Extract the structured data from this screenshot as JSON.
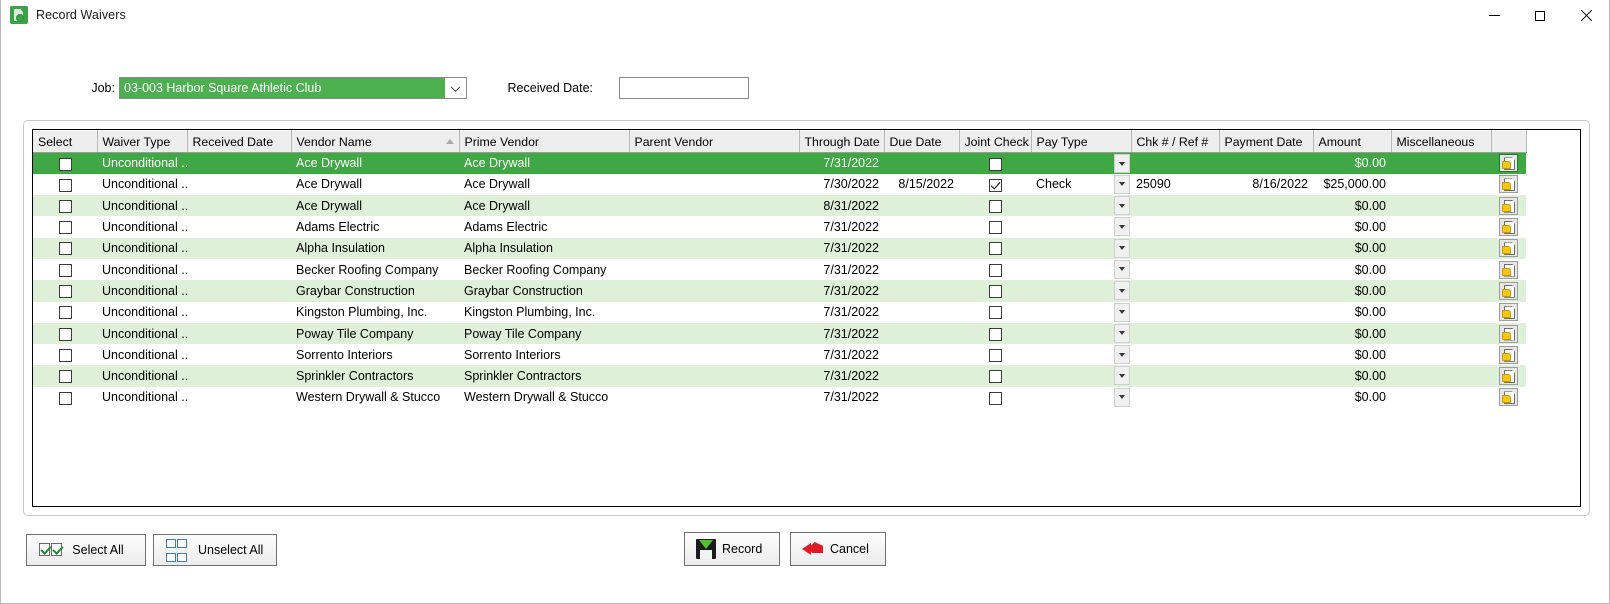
{
  "window": {
    "title": "Record Waivers",
    "icon": "record-waivers-icon",
    "minimize_label": "—",
    "maximize_label": "□",
    "close_label": "✕"
  },
  "form": {
    "job_label": "Job:",
    "job_value": "03-003  Harbor Square Athletic Club",
    "received_date_label": "Received Date:",
    "received_date_value": "",
    "received_date_placeholder": ""
  },
  "grid": {
    "columns": [
      {
        "key": "select",
        "label": "Select"
      },
      {
        "key": "waiver",
        "label": "Waiver Type"
      },
      {
        "key": "received",
        "label": "Received Date"
      },
      {
        "key": "vendor",
        "label": "Vendor Name",
        "sorted": "asc"
      },
      {
        "key": "prime",
        "label": "Prime Vendor"
      },
      {
        "key": "parent",
        "label": "Parent Vendor"
      },
      {
        "key": "through",
        "label": "Through Date"
      },
      {
        "key": "due",
        "label": "Due Date"
      },
      {
        "key": "joint",
        "label": "Joint Check"
      },
      {
        "key": "paytype",
        "label": "Pay Type"
      },
      {
        "key": "chk",
        "label": "Chk # / Ref #"
      },
      {
        "key": "payment",
        "label": "Payment Date"
      },
      {
        "key": "amount",
        "label": "Amount"
      },
      {
        "key": "misc",
        "label": "Miscellaneous"
      },
      {
        "key": "action",
        "label": ""
      }
    ],
    "rows": [
      {
        "select": false,
        "waiver": "Unconditional ...",
        "received": "",
        "vendor": "Ace Drywall",
        "prime": "Ace Drywall",
        "parent": "",
        "through": "7/31/2022",
        "due": "",
        "joint": false,
        "paytype": "",
        "chk": "",
        "payment": "",
        "amount": "$0.00",
        "misc": "",
        "selected": true
      },
      {
        "select": false,
        "waiver": "Unconditional ...",
        "received": "",
        "vendor": "Ace Drywall",
        "prime": "Ace Drywall",
        "parent": "",
        "through": "7/30/2022",
        "due": "8/15/2022",
        "joint": true,
        "paytype": "Check",
        "chk": "25090",
        "payment": "8/16/2022",
        "amount": "$25,000.00",
        "misc": "",
        "selected": false
      },
      {
        "select": false,
        "waiver": "Unconditional ...",
        "received": "",
        "vendor": "Ace Drywall",
        "prime": "Ace Drywall",
        "parent": "",
        "through": "8/31/2022",
        "due": "",
        "joint": false,
        "paytype": "",
        "chk": "",
        "payment": "",
        "amount": "$0.00",
        "misc": "",
        "selected": false
      },
      {
        "select": false,
        "waiver": "Unconditional ...",
        "received": "",
        "vendor": "Adams Electric",
        "prime": "Adams Electric",
        "parent": "",
        "through": "7/31/2022",
        "due": "",
        "joint": false,
        "paytype": "",
        "chk": "",
        "payment": "",
        "amount": "$0.00",
        "misc": "",
        "selected": false
      },
      {
        "select": false,
        "waiver": "Unconditional ...",
        "received": "",
        "vendor": "Alpha Insulation",
        "prime": "Alpha Insulation",
        "parent": "",
        "through": "7/31/2022",
        "due": "",
        "joint": false,
        "paytype": "",
        "chk": "",
        "payment": "",
        "amount": "$0.00",
        "misc": "",
        "selected": false
      },
      {
        "select": false,
        "waiver": "Unconditional ...",
        "received": "",
        "vendor": "Becker Roofing Company",
        "prime": "Becker Roofing Company",
        "parent": "",
        "through": "7/31/2022",
        "due": "",
        "joint": false,
        "paytype": "",
        "chk": "",
        "payment": "",
        "amount": "$0.00",
        "misc": "",
        "selected": false
      },
      {
        "select": false,
        "waiver": "Unconditional ...",
        "received": "",
        "vendor": "Graybar Construction",
        "prime": "Graybar Construction",
        "parent": "",
        "through": "7/31/2022",
        "due": "",
        "joint": false,
        "paytype": "",
        "chk": "",
        "payment": "",
        "amount": "$0.00",
        "misc": "",
        "selected": false
      },
      {
        "select": false,
        "waiver": "Unconditional ...",
        "received": "",
        "vendor": "Kingston Plumbing, Inc.",
        "prime": "Kingston Plumbing, Inc.",
        "parent": "",
        "through": "7/31/2022",
        "due": "",
        "joint": false,
        "paytype": "",
        "chk": "",
        "payment": "",
        "amount": "$0.00",
        "misc": "",
        "selected": false
      },
      {
        "select": false,
        "waiver": "Unconditional ...",
        "received": "",
        "vendor": "Poway Tile Company",
        "prime": "Poway Tile Company",
        "parent": "",
        "through": "7/31/2022",
        "due": "",
        "joint": false,
        "paytype": "",
        "chk": "",
        "payment": "",
        "amount": "$0.00",
        "misc": "",
        "selected": false
      },
      {
        "select": false,
        "waiver": "Unconditional ...",
        "received": "",
        "vendor": "Sorrento Interiors",
        "prime": "Sorrento Interiors",
        "parent": "",
        "through": "7/31/2022",
        "due": "",
        "joint": false,
        "paytype": "",
        "chk": "",
        "payment": "",
        "amount": "$0.00",
        "misc": "",
        "selected": false
      },
      {
        "select": false,
        "waiver": "Unconditional ...",
        "received": "",
        "vendor": "Sprinkler Contractors",
        "prime": "Sprinkler Contractors",
        "parent": "",
        "through": "7/31/2022",
        "due": "",
        "joint": false,
        "paytype": "",
        "chk": "",
        "payment": "",
        "amount": "$0.00",
        "misc": "",
        "selected": false
      },
      {
        "select": false,
        "waiver": "Unconditional ...",
        "received": "",
        "vendor": "Western Drywall & Stucco",
        "prime": "Western Drywall & Stucco",
        "parent": "",
        "through": "7/31/2022",
        "due": "",
        "joint": false,
        "paytype": "",
        "chk": "",
        "payment": "",
        "amount": "$0.00",
        "misc": "",
        "selected": false
      }
    ]
  },
  "buttons": {
    "select_all": "Select All",
    "unselect_all": "Unselect All",
    "record": "Record",
    "cancel": "Cancel"
  },
  "colors": {
    "accent_green": "#3fa845",
    "row_alt_green": "#dff0d8",
    "combo_green": "#4caf50",
    "header_gray": "#ededed"
  }
}
